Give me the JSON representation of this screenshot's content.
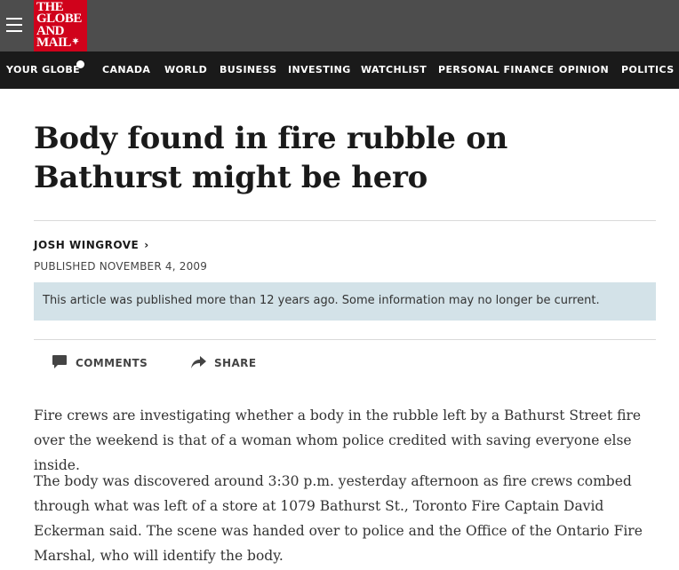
{
  "header": {
    "logo_lines": [
      "THE",
      "GLOBE",
      "AND",
      "MAIL"
    ],
    "brand_color": "#d0021b",
    "menu_icon": "hamburger-menu-icon"
  },
  "nav": {
    "items": [
      {
        "label": "YOUR GLOBE"
      },
      {
        "label": "CANADA"
      },
      {
        "label": "WORLD"
      },
      {
        "label": "BUSINESS"
      },
      {
        "label": "INVESTING"
      },
      {
        "label": "WATCHLIST"
      },
      {
        "label": "PERSONAL FINANCE"
      },
      {
        "label": "OPINION"
      },
      {
        "label": "POLITICS"
      }
    ]
  },
  "article": {
    "headline": "Body found in fire rubble on Bathurst might be hero",
    "author": "JOSH WINGROVE",
    "published": "PUBLISHED NOVEMBER 4, 2009",
    "notice": "This article was published more than 12 years ago. Some information may no longer be current.",
    "actions": {
      "comments_label": "COMMENTS",
      "share_label": "SHARE"
    },
    "paragraphs": [
      "Fire crews are investigating whether a body in the rubble left by a Bathurst Street fire over the weekend is that of a woman whom police credited with saving everyone else inside.",
      "The body was discovered around 3:30 p.m. yesterday afternoon as fire crews combed through what was left of a store at 1079 Bathurst St., Toronto Fire Captain David Eckerman said. The scene was handed over to police and the Office of the Ontario Fire Marshal, who will identify the body."
    ]
  }
}
